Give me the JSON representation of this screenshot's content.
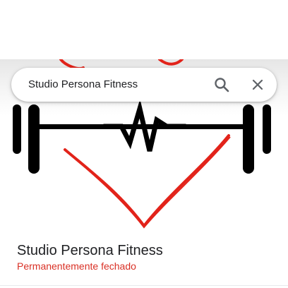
{
  "search": {
    "query": "Studio Persona Fitness",
    "search_icon": "search-icon",
    "close_icon": "close-icon"
  },
  "hero": {
    "image": "heart-heartbeat-dumbbell-logo",
    "colors": {
      "heart": "#e2231a",
      "barbell": "#000000"
    }
  },
  "place": {
    "name": "Studio Persona Fitness",
    "status": "Permanentemente fechado",
    "status_color": "#d93025"
  }
}
